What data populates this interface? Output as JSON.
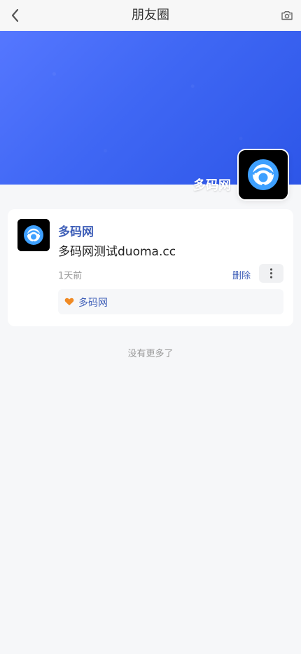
{
  "header": {
    "title": "朋友圈",
    "back_icon": "chevron-left-icon",
    "camera_icon": "camera-icon"
  },
  "profile": {
    "name": "多码网",
    "avatar_icon": "customer-service-logo-icon"
  },
  "post": {
    "author": "多码网",
    "content": "多码网测试duoma.cc",
    "time": "1天前",
    "delete_label": "删除",
    "more_icon": "more-vertical-icon",
    "likes": [
      {
        "name": "多码网",
        "icon": "heart-icon"
      }
    ]
  },
  "footer": {
    "end_text": "没有更多了"
  },
  "colors": {
    "nav_background": "#f7f7f7",
    "page_background": "#f6f7f9",
    "cover_start": "#5577ff",
    "cover_end": "#2d56e8",
    "link": "#3f5fb8",
    "heart": "#f08a24"
  }
}
